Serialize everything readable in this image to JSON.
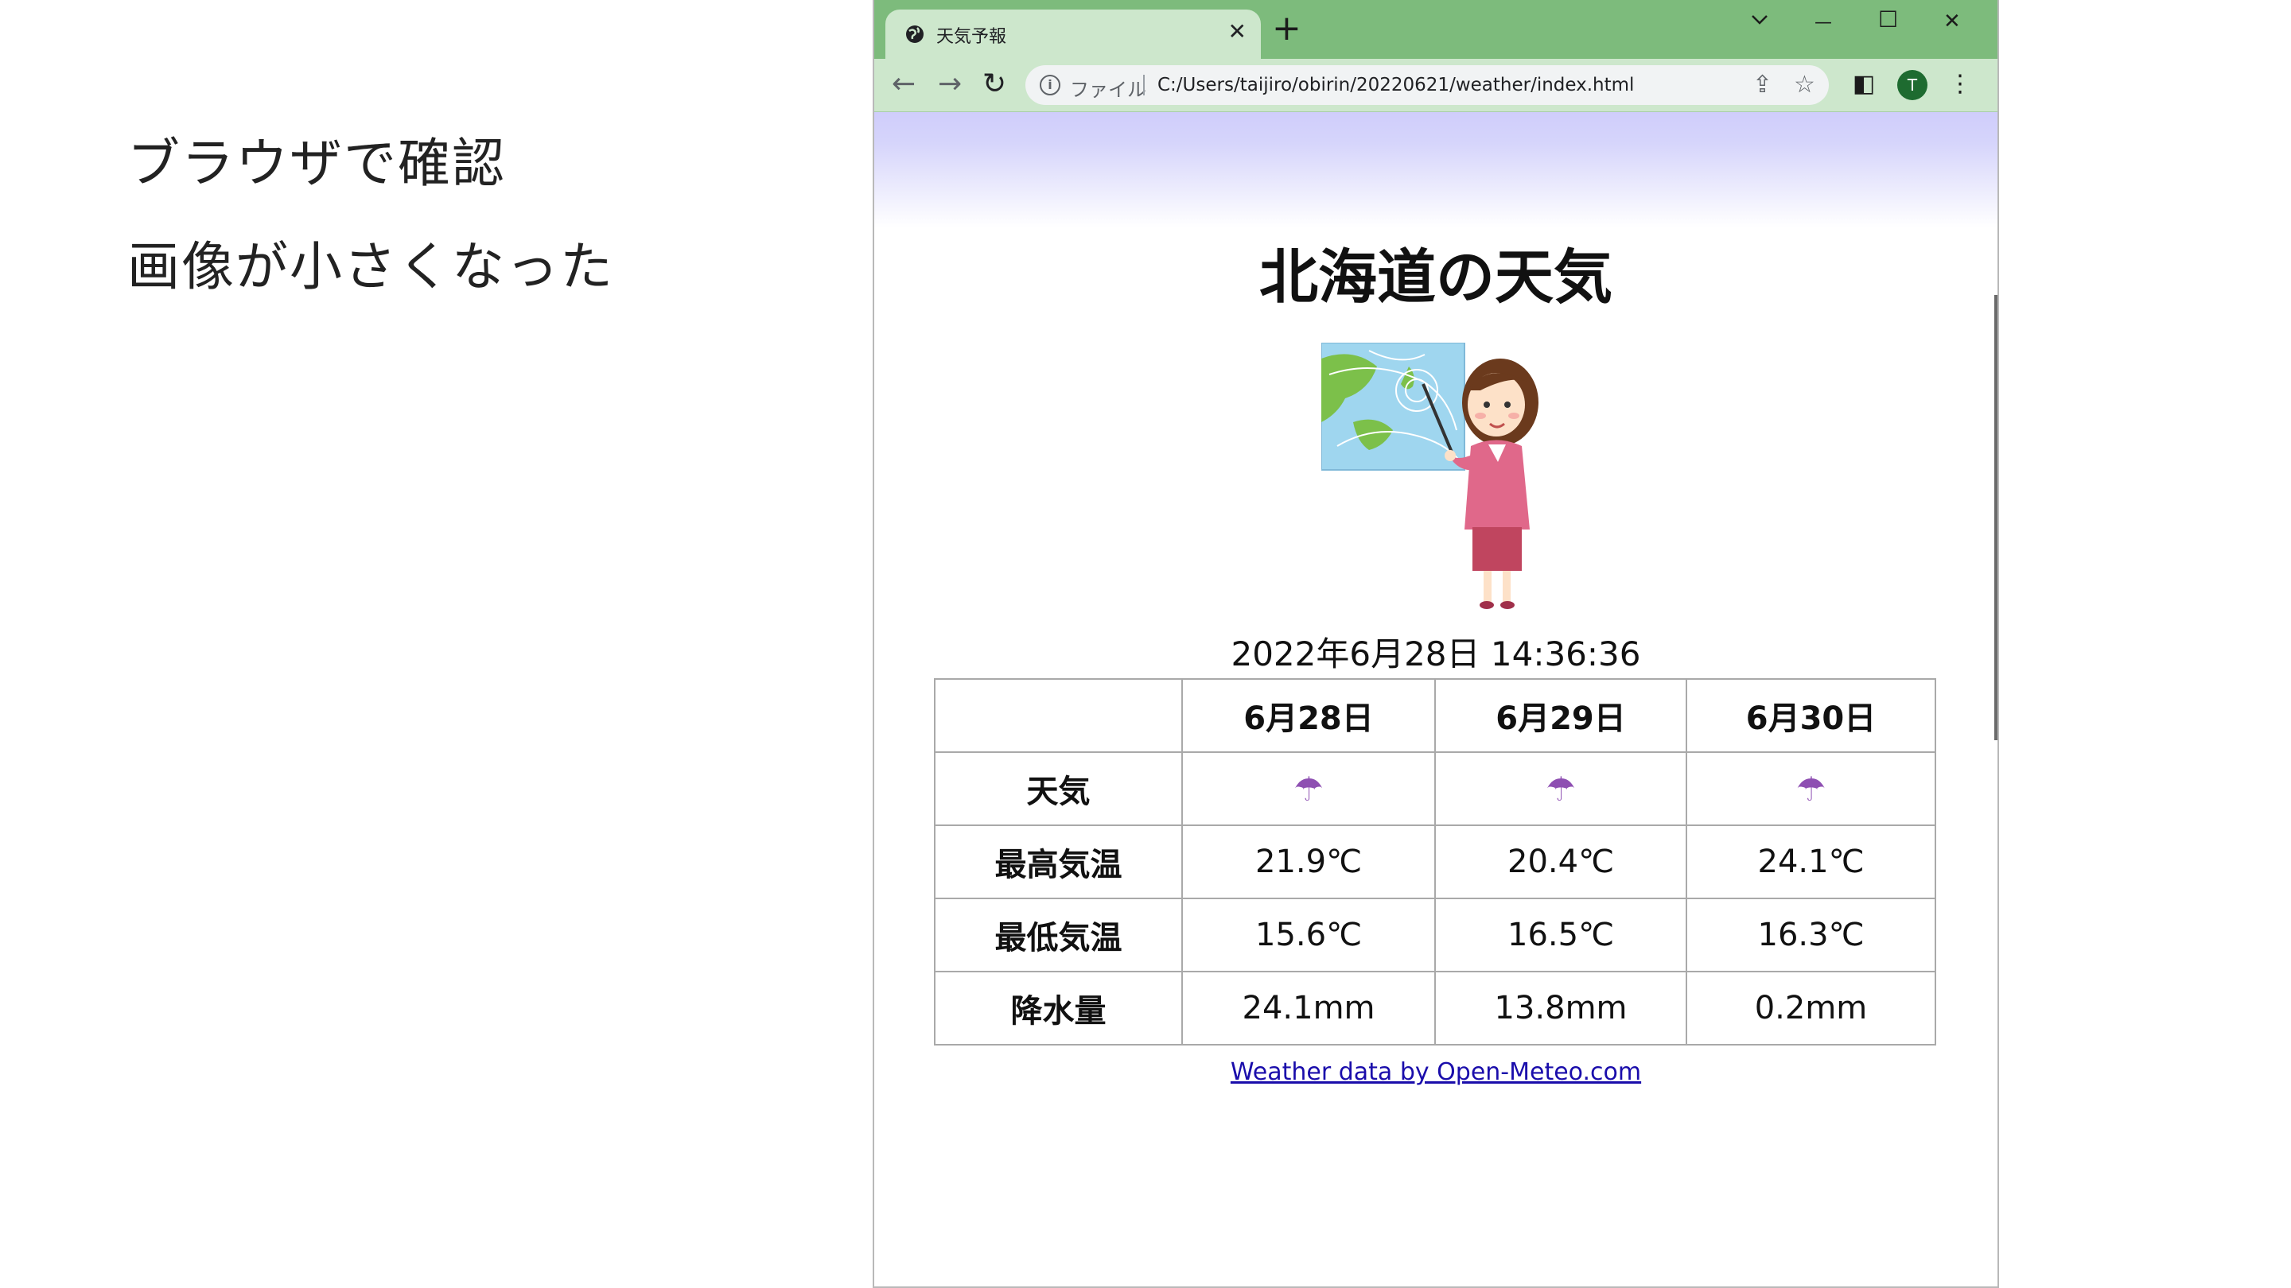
{
  "slide": {
    "note1": "ブラウザで確認",
    "note2": "画像が小さくなった"
  },
  "browser": {
    "tab_title": "天気予報",
    "tab_close": "✕",
    "new_tab": "+",
    "win_min": "—",
    "win_max": "☐",
    "win_close": "✕",
    "back": "←",
    "forward": "→",
    "reload": "↻",
    "scheme": "ファイル",
    "url": "C:/Users/taijiro/obirin/20220621/weather/index.html",
    "share": "⇪",
    "bookmark": "☆",
    "sidepanel": "◧",
    "avatar": "T",
    "menu": "⋮"
  },
  "page": {
    "title": "北海道の天気",
    "datetime": "2022年6月28日 14:36:36",
    "credit": "Weather data by Open-Meteo.com",
    "table": {
      "dates": [
        "6月28日",
        "6月29日",
        "6月30日"
      ],
      "rows": [
        {
          "label": "天気",
          "values": [
            "☂",
            "☂",
            "☂"
          ]
        },
        {
          "label": "最高気温",
          "values": [
            "21.9℃",
            "20.4℃",
            "24.1℃"
          ]
        },
        {
          "label": "最低気温",
          "values": [
            "15.6℃",
            "16.5℃",
            "16.3℃"
          ]
        },
        {
          "label": "降水量",
          "values": [
            "24.1mm",
            "13.8mm",
            "0.2mm"
          ]
        }
      ]
    }
  },
  "colors": {
    "titlebar": "#7dbb7c",
    "toolbar": "#cde7cc",
    "header_gradient": "#cfcdfb",
    "umbrella": "#8e4fb2",
    "link": "#1a0dab"
  }
}
